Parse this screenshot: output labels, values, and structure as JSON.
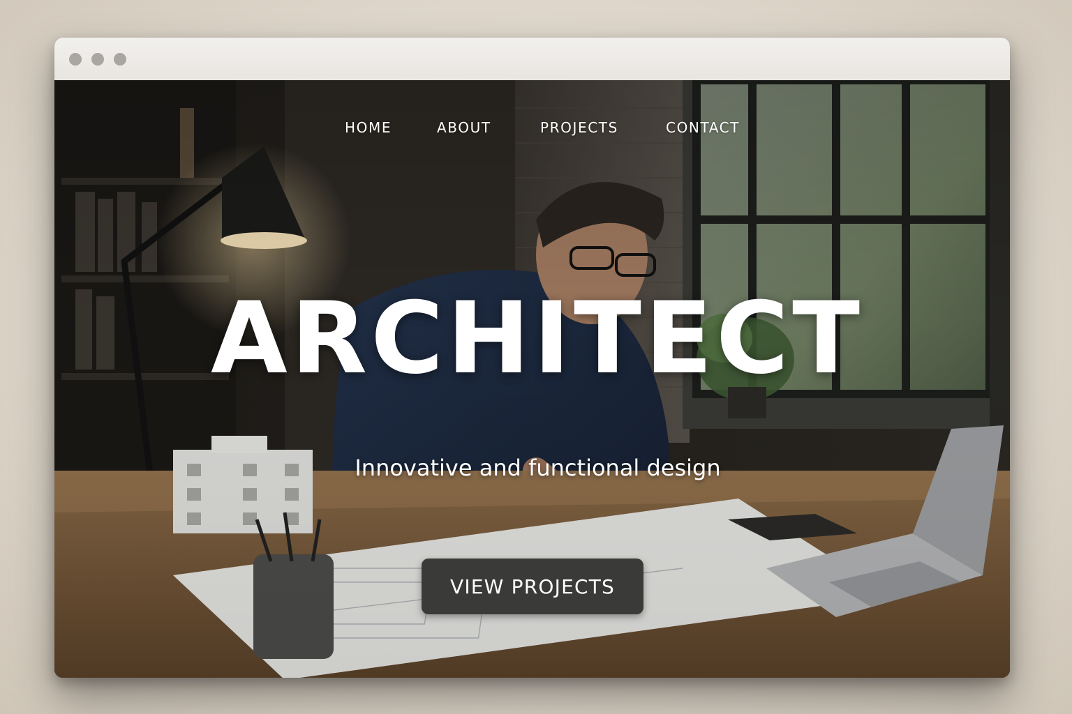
{
  "nav": {
    "home": "HOME",
    "about": "ABOUT",
    "projects": "PROJECTS",
    "contact": "CONTACT"
  },
  "hero": {
    "title": "ARCHITECT",
    "subtitle": "Innovative and functional design",
    "cta_label": "VIEW PROJECTS"
  },
  "colors": {
    "cta_background": "#3a3a39",
    "text": "#ffffff",
    "titlebar": "#efece8",
    "window_dots": "#a9a6a2"
  },
  "background_image": "architect-at-drafting-desk-photo"
}
